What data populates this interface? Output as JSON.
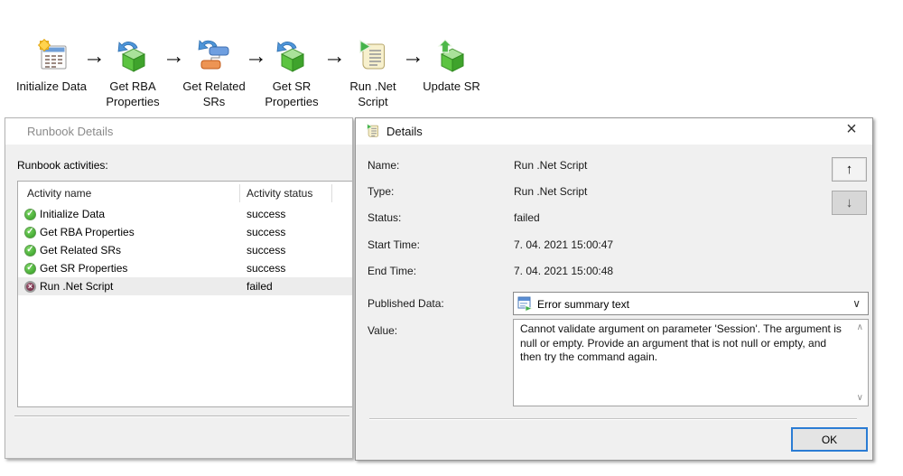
{
  "workflow": {
    "arrow_glyph": "→",
    "steps": [
      {
        "label": "Initialize Data",
        "icon": "new-data-table-icon"
      },
      {
        "label": "Get RBA Properties",
        "icon": "get-activity-cube-icon"
      },
      {
        "label": "Get Related SRs",
        "icon": "get-related-items-icon"
      },
      {
        "label": "Get SR Properties",
        "icon": "get-activity-cube-icon"
      },
      {
        "label": "Run .Net Script",
        "icon": "run-script-icon"
      },
      {
        "label": "Update SR",
        "icon": "update-cube-icon"
      }
    ]
  },
  "runbook_window": {
    "title": "Runbook Details",
    "activities_label": "Runbook activities:",
    "columns": {
      "name": "Activity name",
      "status": "Activity status"
    },
    "rows": [
      {
        "name": "Initialize Data",
        "status": "success"
      },
      {
        "name": "Get RBA Properties",
        "status": "success"
      },
      {
        "name": "Get Related SRs",
        "status": "success"
      },
      {
        "name": "Get SR Properties",
        "status": "success"
      },
      {
        "name": "Run .Net Script",
        "status": "failed"
      }
    ],
    "selected_row": "Run .Net Script"
  },
  "details_dialog": {
    "title": "Details",
    "close_glyph": "×",
    "up_glyph": "↑",
    "down_glyph": "↓",
    "fields": [
      {
        "label": "Name:",
        "value": "Run .Net Script"
      },
      {
        "label": "Type:",
        "value": "Run .Net Script"
      },
      {
        "label": "Status:",
        "value": "failed"
      },
      {
        "label": "Start Time:",
        "value": "7. 04. 2021 15:00:47"
      },
      {
        "label": "End Time:",
        "value": "7. 04. 2021 15:00:48"
      }
    ],
    "published_data": {
      "label": "Published Data:",
      "selected_option": "Error summary text",
      "chevron_glyph": "∨"
    },
    "value_field": {
      "label": "Value:",
      "text": "Cannot validate argument on parameter 'Session'. The argument is null or empty. Provide an argument that is not null or empty, and then try the command again.",
      "scroll_up_glyph": "∧",
      "scroll_down_glyph": "∨"
    },
    "ok_label": "OK"
  },
  "status_glyphs": {
    "success": "✓",
    "failed": "×"
  },
  "colors": {
    "success_icon": "#3ba629",
    "failed_icon": "#7c2744",
    "ok_button_border": "#2a7cd4",
    "window_bg": "#f0f0f0",
    "selected_row_bg": "#ececec",
    "runbook_title_text": "#8a8a8a"
  }
}
